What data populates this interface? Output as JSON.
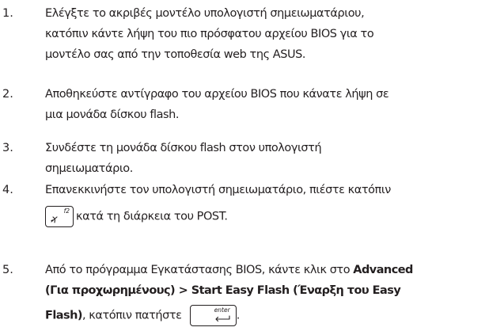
{
  "steps": [
    {
      "number": "1.",
      "lines": [
        "Ελέγξτε το ακριβές μοντέλο υπολογιστή σημειωματάριου,",
        "κατόπιν κάντε λήψη του πιο πρόσφατου αρχείου BIOS για το",
        "μοντέλο σας από την τοποθεσία web της ASUS."
      ]
    },
    {
      "number": "2.",
      "lines": [
        "Αποθηκεύστε αντίγραφο του αρχείου BIOS που κάνατε λήψη σε",
        "μια μονάδα δίσκου flash."
      ]
    },
    {
      "number": "3.",
      "lines": [
        "Συνδέστε τη μονάδα δίσκου flash στον υπολογιστή",
        "σημειωματάριο."
      ]
    },
    {
      "number": "4.",
      "line1": "Επανεκκινήστε τον υπολογιστή σημειωματάριο, πιέστε κατόπιν",
      "line2_after_key": "κατά τη διάρκεια του POST.",
      "key": {
        "label": "f2",
        "icon": "airplane-icon"
      }
    },
    {
      "number": "5.",
      "line1_pre": "Από το πρόγραμμα Εγκατάστασης BIOS, κάντε κλικ στο ",
      "line1_bold": "Advanced",
      "line2_bold": "(Για προχωρημένους) > Start Easy Flash (Έναρξη του Easy",
      "line3_bold": "Flash)",
      "line3_mid": ", κατόπιν πατήστε ",
      "line3_end": ".",
      "key": {
        "label": "enter",
        "icon": "enter-arrow-icon"
      }
    }
  ]
}
